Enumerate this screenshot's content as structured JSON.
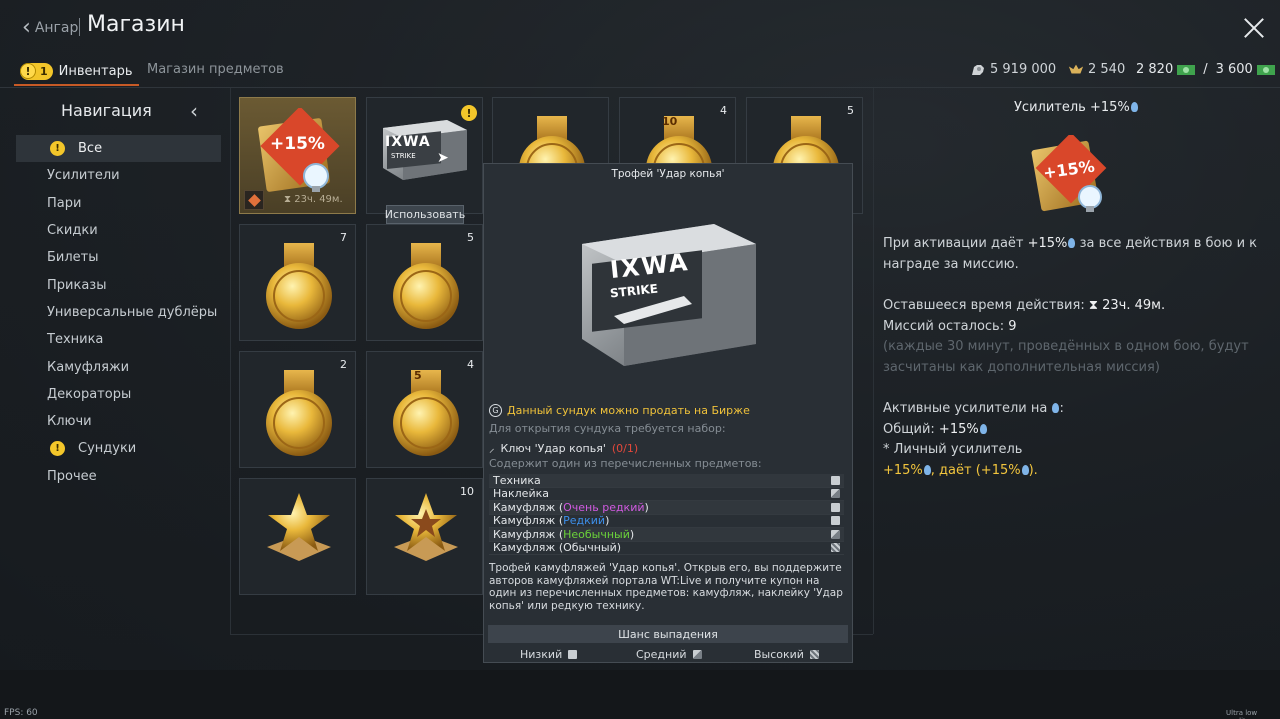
{
  "header": {
    "back_label": "Ангар",
    "title": "Магазин"
  },
  "tabs": {
    "inventory_badge": "1",
    "inventory_label": "Инвентарь",
    "shop_label": "Магазин предметов"
  },
  "currency": {
    "silver": "5 919 000",
    "eagles": "2 540",
    "ge": "2 820",
    "ge_sep": "/",
    "ge_max": "3 600"
  },
  "nav": {
    "title": "Навигация",
    "items": [
      {
        "label": "Все"
      },
      {
        "label": "Усилители"
      },
      {
        "label": "Пари"
      },
      {
        "label": "Скидки"
      },
      {
        "label": "Билеты"
      },
      {
        "label": "Приказы"
      },
      {
        "label": "Универсальные дублёры"
      },
      {
        "label": "Техника"
      },
      {
        "label": "Камуфляжи"
      },
      {
        "label": "Декораторы"
      },
      {
        "label": "Ключи"
      },
      {
        "label": "Сундуки"
      },
      {
        "label": "Прочее"
      }
    ]
  },
  "grid": {
    "booster_label": "+15%",
    "booster_timer": "23ч. 49м.",
    "crate_text_1": "IXWA",
    "crate_text_2": "STRIKE",
    "medal_10_label": "10",
    "medal_5_label": "5",
    "counts": {
      "c04": "4",
      "c05": "5",
      "c10": "7",
      "c11": "5",
      "c20": "2",
      "c21": "4",
      "c31": "10"
    },
    "use_button": "Использовать"
  },
  "tooltip": {
    "title": "Трофей 'Удар копья'",
    "sell_icon": "G",
    "sell": "Данный сундук можно продать на Бирже",
    "requires": "Для открытия сундука требуется набор:",
    "key_label": "Ключ 'Удар копья'",
    "key_count": "(0/1)",
    "contains": "Содержит один из перечисленных предметов:",
    "rows": [
      {
        "label": "Техника",
        "rarity": ""
      },
      {
        "label": "Наклейка",
        "rarity": ""
      },
      {
        "label": "Камуфляж (",
        "rarity": "Очень редкий",
        "close": ")"
      },
      {
        "label": "Камуфляж (",
        "rarity": "Редкий",
        "close": ")"
      },
      {
        "label": "Камуфляж (",
        "rarity": "Необычный",
        "close": ")"
      },
      {
        "label": "Камуфляж (Обычный)",
        "rarity": ""
      }
    ],
    "description": "Трофей камуфляжей 'Удар копья'. Открыв его, вы поддержите авторов камуфляжей портала WT:Live и получите купон на один из перечисленных предметов: камуфляж, наклейку 'Удар копья' или редкую технику.",
    "chance_bar": "Шанс выпадения",
    "legend": {
      "low": "Низкий",
      "mid": "Средний",
      "high": "Высокий"
    }
  },
  "right_panel": {
    "title": "Усилитель +15%",
    "booster_label": "+15%",
    "line1a": "При активации даёт",
    "line1b": "+15%",
    "line1c": "за все действия в бою и к",
    "line2": "награде за миссию.",
    "remaining_label": "Оставшееся время действия:",
    "remaining_icon": "⧗",
    "remaining_value": "23ч. 49м.",
    "missions_label": "Миссий осталось:",
    "missions_value": "9",
    "note1": "(каждые 30 минут, проведённых в одном бою, будут",
    "note2": "засчитаны как дополнительная миссия)",
    "active_label": "Активные усилители на",
    "active_suffix": ":",
    "total_label": "Общий:",
    "total_value": "+15%",
    "personal_label": "* Личный усилитель",
    "personal_value_a": "+15%",
    "personal_value_b": ", даёт (",
    "personal_value_c": "+15%",
    "personal_value_d": ")."
  },
  "footer": {
    "fps": "FPS: 60",
    "quality": "Ultra low quality"
  },
  "colors": {
    "accent": "#c75a26",
    "gold": "#f2c53d",
    "warning": "#f3c62a",
    "error": "#e2483b"
  }
}
